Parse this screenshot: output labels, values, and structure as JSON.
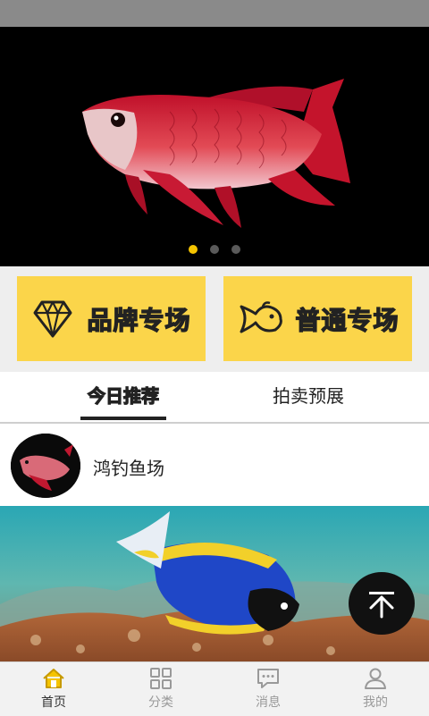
{
  "colors": {
    "accent": "#f5c400",
    "button_bg": "#fbd54a",
    "dark": "#111111"
  },
  "banner": {
    "image": "red-arowana-fish",
    "slide_count": 3,
    "active_slide": 1
  },
  "quick_buttons": [
    {
      "label": "品牌专场",
      "icon": "diamond-icon"
    },
    {
      "label": "普通专场",
      "icon": "fish-icon"
    }
  ],
  "tabs": [
    {
      "label": "今日推荐",
      "active": true
    },
    {
      "label": "拍卖预展",
      "active": false
    }
  ],
  "shop": {
    "name": "鸿钓鱼场",
    "avatar": "arowana-avatar"
  },
  "photo": {
    "image": "blue-tang-fish-reef"
  },
  "scroll_top_icon": "back-to-top-icon",
  "bottom_nav": [
    {
      "label": "首页",
      "icon": "home-icon",
      "active": true
    },
    {
      "label": "分类",
      "icon": "grid-icon",
      "active": false
    },
    {
      "label": "消息",
      "icon": "message-icon",
      "active": false
    },
    {
      "label": "我的",
      "icon": "user-icon",
      "active": false
    }
  ]
}
